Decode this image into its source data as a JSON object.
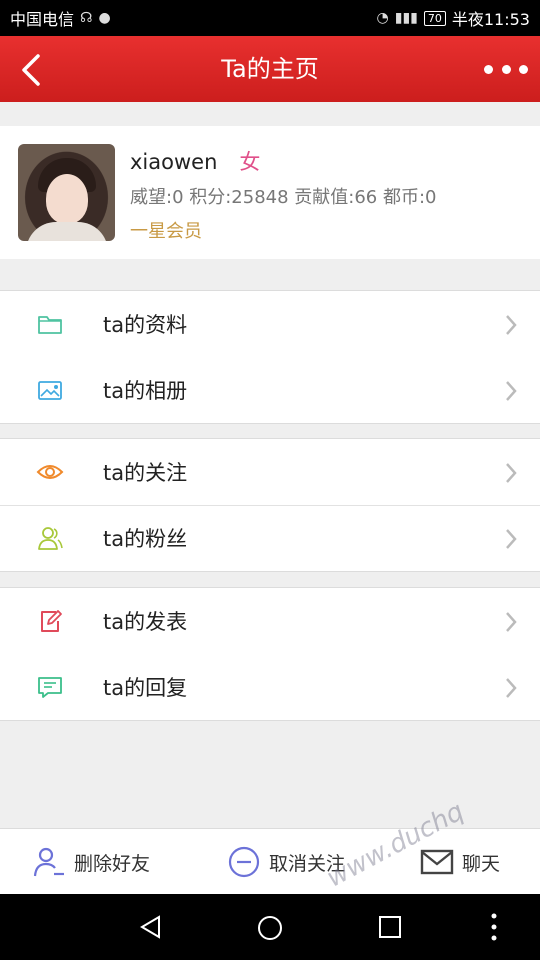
{
  "status_bar": {
    "carrier": "中国电信",
    "battery": "70",
    "time": "半夜11:53"
  },
  "header": {
    "title": "Ta的主页"
  },
  "profile": {
    "username": "xiaowen",
    "gender": "女",
    "stats": "威望:0 积分:25848 贡献值:66 都币:0",
    "level": "一星会员"
  },
  "menu_groups": [
    [
      {
        "label": "ta的资料",
        "icon": "folder-icon",
        "color": "#4fc3a1"
      },
      {
        "label": "ta的相册",
        "icon": "photo-icon",
        "color": "#3fa9e0"
      }
    ],
    [
      {
        "label": "ta的关注",
        "icon": "eye-icon",
        "color": "#f08a2c"
      },
      {
        "label": "ta的粉丝",
        "icon": "users-icon",
        "color": "#a8c83a"
      }
    ],
    [
      {
        "label": "ta的发表",
        "icon": "edit-icon",
        "color": "#e04a5a"
      },
      {
        "label": "ta的回复",
        "icon": "comment-icon",
        "color": "#3bbf8a"
      }
    ]
  ],
  "actions": {
    "delete_friend": "删除好友",
    "unfollow": "取消关注",
    "chat": "聊天"
  },
  "watermark": "www.duchq"
}
